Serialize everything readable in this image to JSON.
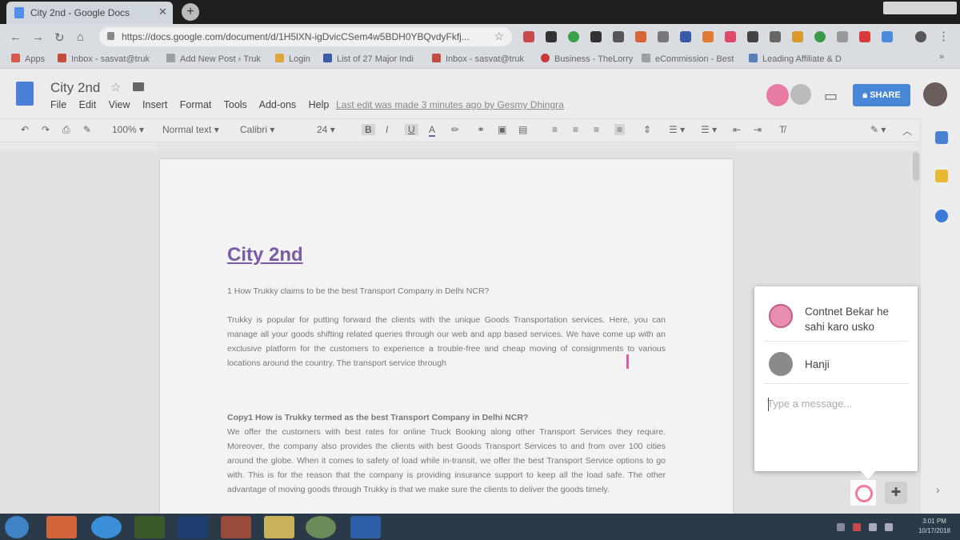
{
  "browser": {
    "tab_title": "City 2nd - Google Docs",
    "url": "https://docs.google.com/document/d/1H5lXN-igDvicCSem4w5BDH0YBQvdyFkfj...",
    "bookmarks": [
      {
        "label": "Apps",
        "color": "#d65b4a"
      },
      {
        "label": "Inbox - sasvat@truk",
        "color": "#c24c3d"
      },
      {
        "label": "Add New Post ‹ Truk",
        "color": "#9aa0a6"
      },
      {
        "label": "Login",
        "color": "#e0a43a"
      },
      {
        "label": "List of 27 Major Indi",
        "color": "#3a5aa8"
      },
      {
        "label": "Inbox - sasvat@truk",
        "color": "#c24c3d"
      },
      {
        "label": "Business - TheLorry",
        "color": "#c63a3a"
      },
      {
        "label": "eCommission - Best",
        "color": "#9aa0a6"
      },
      {
        "label": "Leading Affiliate & D",
        "color": "#5a7fb8"
      }
    ]
  },
  "docs": {
    "title": "City 2nd",
    "menu": [
      "File",
      "Edit",
      "View",
      "Insert",
      "Format",
      "Tools",
      "Add-ons",
      "Help"
    ],
    "last_edit": "Last edit was made 3 minutes ago by Gesmy Dhingra",
    "share_label": "SHARE",
    "format": {
      "zoom": "100%",
      "style": "Normal text",
      "font": "Calibri",
      "size": "24"
    }
  },
  "document": {
    "heading": "City 2nd",
    "q1": "1 How Trukky claims to be the best Transport Company in Delhi NCR?",
    "p1": "Trukky is popular for putting forward the clients with the unique Goods Transportation services. Here, you can manage all your goods shifting related queries through our web and app based services. We have come up with an exclusive platform for the customers to experience a trouble-free and cheap moving of consignments to various locations around the country. The transport service through",
    "q2": "Copy1 How is Trukky termed as the best Transport Company in Delhi NCR?",
    "p2": "We offer the customers with best rates for online Truck Booking along other Transport Services they require. Moreover, the company also provides the clients with best Goods Transport Services to and from over 100 cities around the globe. When it comes to safety of load while in-transit, we offer the best Transport Service options to go with. This is for the reason that the company is providing insurance support to keep all the load safe. The other advantage of moving goods through Trukky is that we make sure the clients to deliver the goods timely."
  },
  "chat": {
    "messages": [
      {
        "text": "Contnet Bekar he sahi karo usko",
        "avatar_color": "#e98fb4"
      },
      {
        "text": "Hanji",
        "avatar_color": "#8a8a8a"
      }
    ],
    "input_placeholder": "Type a message..."
  },
  "taskbar": {
    "time": "3:01 PM",
    "date": "10/17/2018",
    "apps": [
      {
        "name": "start-orb",
        "color": "#3f83c7"
      },
      {
        "name": "powerpoint",
        "color": "#d4643a"
      },
      {
        "name": "internet-explorer",
        "color": "#3a8fd8"
      },
      {
        "name": "terminal",
        "color": "#3a5a2a"
      },
      {
        "name": "photoshop",
        "color": "#1f3f70"
      },
      {
        "name": "paint",
        "color": "#9a4a3a"
      },
      {
        "name": "file-explorer",
        "color": "#c9b25a"
      },
      {
        "name": "chrome",
        "color": "#6a8c5a"
      },
      {
        "name": "word",
        "color": "#2e5fa6"
      }
    ]
  }
}
